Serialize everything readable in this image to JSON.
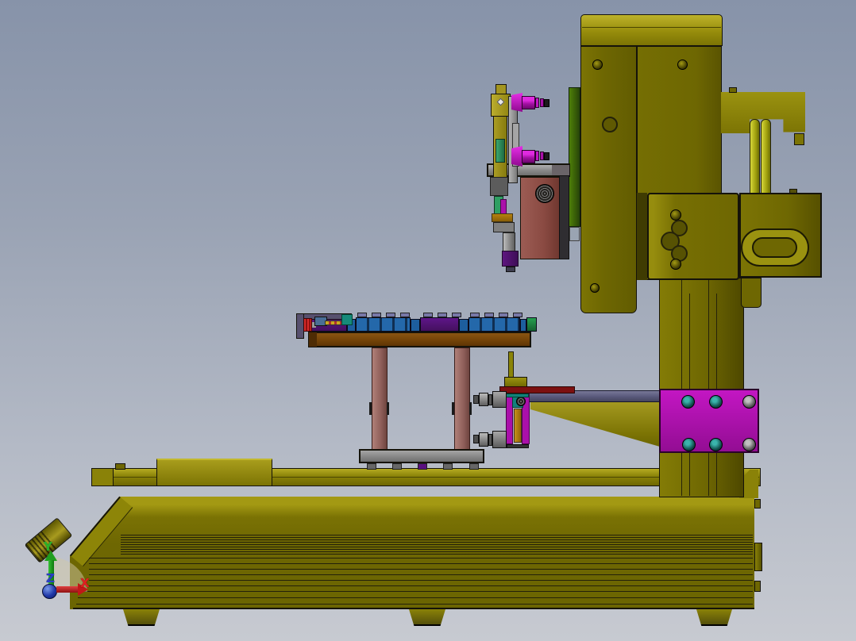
{
  "viewport": {
    "description": "3D CAD side view of an automated desktop dispensing machine",
    "background_top": "#8793a9",
    "background_bottom": "#c7cad1"
  },
  "triad": {
    "x_label": "X",
    "y_label": "Y",
    "z_label": "Z",
    "x_color": "#e02020",
    "y_color": "#2ab32a",
    "z_color": "#2a3ec8"
  },
  "palette": {
    "olive_front": "#6e6702",
    "olive_top": "#b5ab22",
    "olive_side": "#8a8208",
    "chain_yellow": "#c6c62e",
    "magenta_fitting": "#c012c0",
    "magenta_plate": "#a80ca8",
    "teal": "#12807a",
    "green_panel": "#3f6b08",
    "green_rod": "#2f9f63",
    "slate_rail": "#606082",
    "dark_red_plate": "#7c1010",
    "maroon_block": "#8a4a42",
    "leg_mauve": "#9c6f6b",
    "table_brown": "#744408",
    "fixture_purple": "#5e1688",
    "fixture_blue": "#2468aa",
    "fixture_green": "#27a050",
    "gray_metal": "#8a8a8a",
    "orange_rod": "#b5820f",
    "red_knob": "#d42a2a"
  },
  "parts": [
    "machine-base",
    "leveling-knob",
    "base-rail",
    "slider-block",
    "base-foot",
    "gantry-column",
    "z-mounting-plate",
    "z-axis-head",
    "cable-chain",
    "cable-chain-loop",
    "chain-bracket-arm",
    "motor-block",
    "work-table",
    "table-leg",
    "fixture-strip",
    "clamp-bracket",
    "dispense-tool-head",
    "camera-barrel",
    "nozzle",
    "lower-dispense-unit",
    "support-arm",
    "origin-triad"
  ]
}
